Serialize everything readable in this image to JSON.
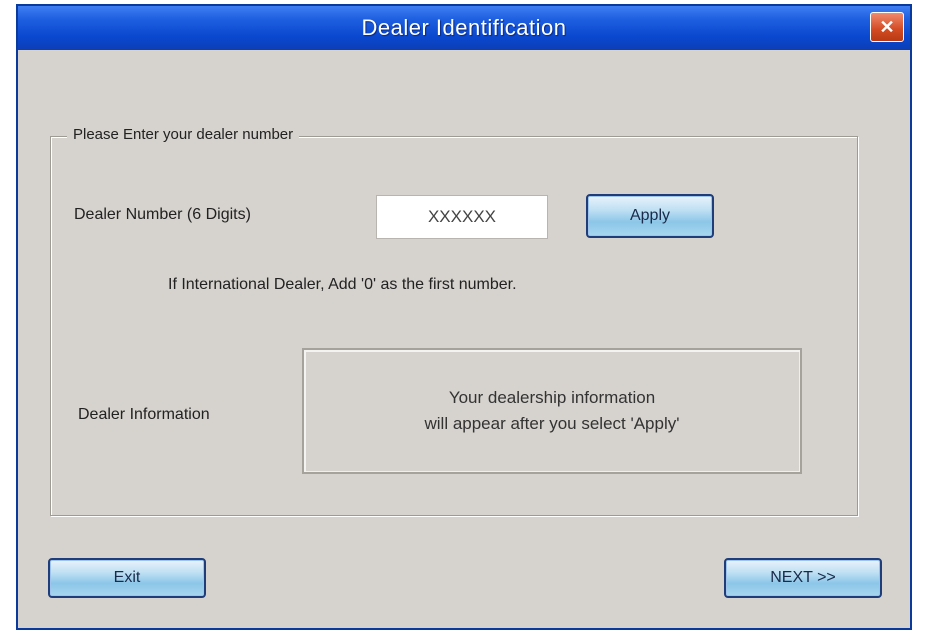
{
  "window": {
    "title": "Dealer Identification",
    "close_label": "✕"
  },
  "group": {
    "legend": "Please Enter your dealer number"
  },
  "dealer_number": {
    "label": "Dealer Number (6 Digits)",
    "value": "XXXXXX"
  },
  "buttons": {
    "apply": "Apply",
    "exit": "Exit",
    "next": "NEXT >>"
  },
  "hint": "If International Dealer, Add '0' as the first number.",
  "dealer_info": {
    "label": "Dealer Information",
    "line1": "Your dealership information",
    "line2": "will appear after you select 'Apply'"
  }
}
